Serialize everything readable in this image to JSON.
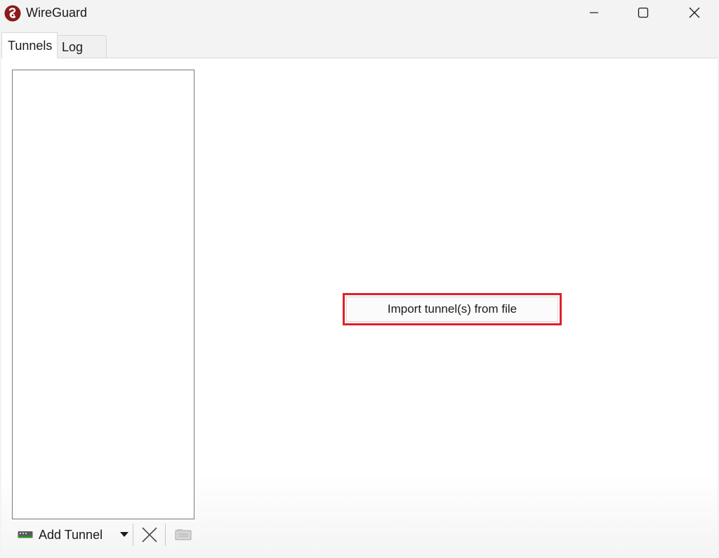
{
  "window": {
    "title": "WireGuard",
    "app_icon": "wireguard-logo-icon",
    "controls": [
      "minimize-icon",
      "maximize-icon",
      "close-icon"
    ]
  },
  "tabs": [
    {
      "label": "Tunnels",
      "selected": true
    },
    {
      "label": "Log",
      "selected": false
    }
  ],
  "tunnels": {
    "items": []
  },
  "toolbar": {
    "add_tunnel_label": "Add Tunnel",
    "add_icon": "network-adapter-icon",
    "dropdown_icon": "dropdown-arrow-icon",
    "delete_icon": "delete-x-icon",
    "export_icon": "export-zip-icon"
  },
  "main": {
    "import_button_label": "Import tunnel(s) from file",
    "highlight_color": "#e0202a"
  },
  "colors": {
    "brand": "#8b1a1a"
  }
}
